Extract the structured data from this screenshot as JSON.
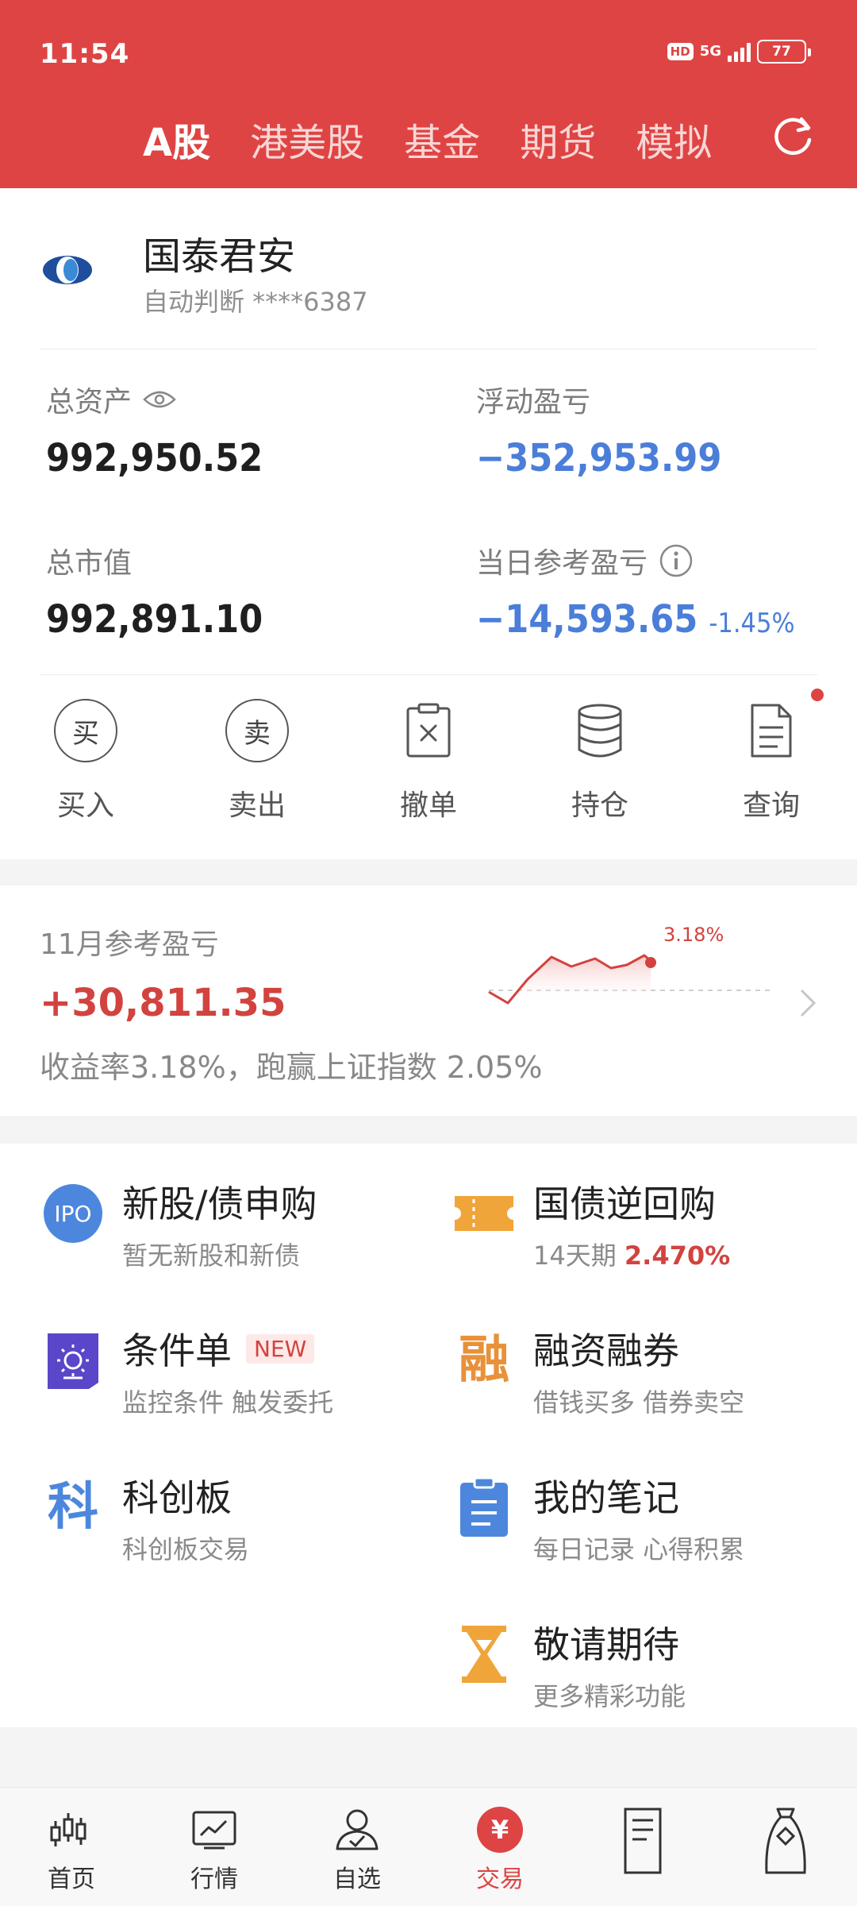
{
  "status": {
    "time": "11:54",
    "hd": "HD",
    "network": "5G",
    "battery": "77"
  },
  "tabs": [
    {
      "label": "A股",
      "active": true
    },
    {
      "label": "港美股",
      "active": false
    },
    {
      "label": "基金",
      "active": false
    },
    {
      "label": "期货",
      "active": false
    },
    {
      "label": "模拟",
      "active": false
    }
  ],
  "account": {
    "broker": "国泰君安",
    "subtitle": "自动判断 ****6387"
  },
  "metrics": {
    "total_assets_label": "总资产",
    "total_assets": "992,950.52",
    "floating_pl_label": "浮动盈亏",
    "floating_pl": "−352,953.99",
    "market_value_label": "总市值",
    "market_value": "992,891.10",
    "daily_pl_label": "当日参考盈亏",
    "daily_pl": "−14,593.65",
    "daily_pl_pct": "-1.45%"
  },
  "actions": [
    {
      "label": "买入",
      "glyph": "买",
      "icon": "buy-icon"
    },
    {
      "label": "卖出",
      "glyph": "卖",
      "icon": "sell-icon"
    },
    {
      "label": "撤单",
      "icon": "cancel-order-icon"
    },
    {
      "label": "持仓",
      "icon": "positions-icon"
    },
    {
      "label": "查询",
      "icon": "query-icon"
    }
  ],
  "monthly": {
    "label": "11月参考盈亏",
    "value": "+30,811.35",
    "desc": "收益率3.18%，跑赢上证指数 2.05%",
    "chart_pct": "3.18%"
  },
  "services": {
    "ipo": {
      "title": "新股/债申购",
      "subtitle": "暂无新股和新债",
      "icon_text": "IPO"
    },
    "repo": {
      "title": "国债逆回购",
      "subtitle_prefix": "14天期",
      "subtitle_value": "2.470%"
    },
    "conditional": {
      "title": "条件单",
      "badge": "NEW",
      "subtitle": "监控条件 触发委托"
    },
    "margin": {
      "title": "融资融券",
      "subtitle": "借钱买多 借券卖空",
      "icon_text": "融"
    },
    "star": {
      "title": "科创板",
      "subtitle": "科创板交易",
      "icon_text": "科"
    },
    "notes": {
      "title": "我的笔记",
      "subtitle": "每日记录 心得积累"
    },
    "coming": {
      "title": "敬请期待",
      "subtitle": "更多精彩功能"
    }
  },
  "bottom_nav": [
    {
      "label": "首页",
      "icon": "home-candles-icon",
      "active": false
    },
    {
      "label": "行情",
      "icon": "market-chart-icon",
      "active": false
    },
    {
      "label": "自选",
      "icon": "watchlist-user-icon",
      "active": false
    },
    {
      "label": "交易",
      "icon": "trade-yuan-icon",
      "active": true,
      "glyph": "¥"
    },
    {
      "label": "",
      "icon": "document-icon",
      "active": false
    },
    {
      "label": "",
      "icon": "moneybag-icon",
      "active": false
    }
  ],
  "colors": {
    "brand_red": "#de4443",
    "loss_blue": "#4b7ed9",
    "gain_red": "#d2433f"
  }
}
